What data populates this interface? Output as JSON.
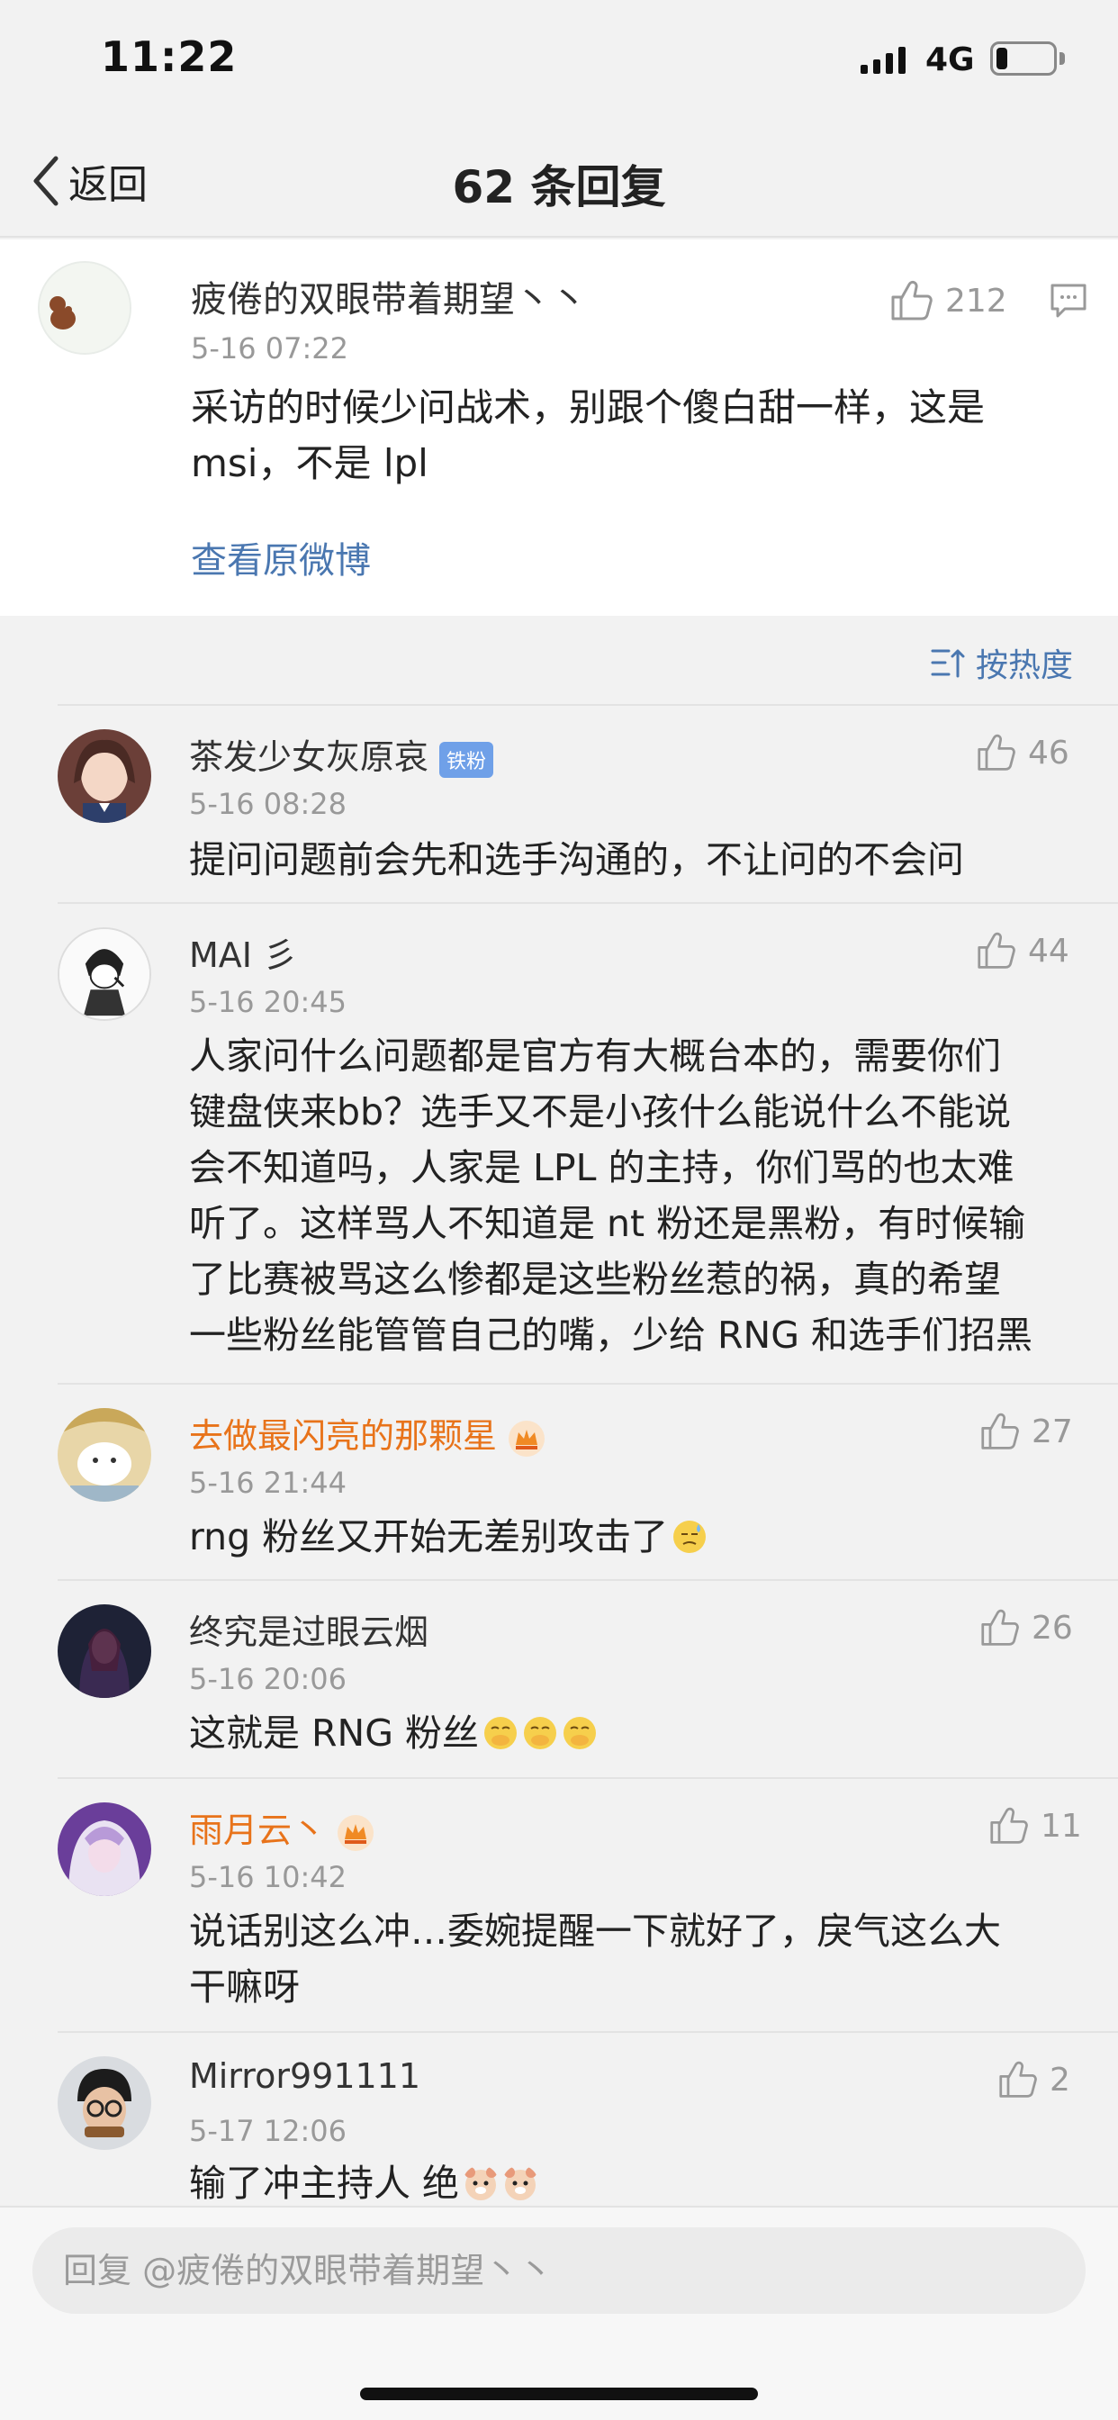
{
  "status": {
    "time": "11:22",
    "network": "4G"
  },
  "nav": {
    "back_label": "返回",
    "title": "62 条回复"
  },
  "original": {
    "username": "疲倦的双眼带着期望丶丶",
    "time": "5-16 07:22",
    "likes": "212",
    "content_lines": [
      "采访的时候少问战术，别跟个傻白甜一样，这是",
      "msi，不是 lpl"
    ],
    "view_original": "查看原微博"
  },
  "sort": {
    "label": "按热度"
  },
  "replies": [
    {
      "username": "茶发少女灰原哀",
      "badge": "铁粉",
      "time": "5-16 08:28",
      "likes": "46",
      "lines": [
        "提问问题前会先和选手沟通的，不让问的不会问"
      ]
    },
    {
      "username": "MAI 彡",
      "time": "5-16 20:45",
      "likes": "44",
      "lines": [
        "人家问什么问题都是官方有大概台本的，需要你们",
        "键盘侠来bb？选手又不是小孩什么能说什么不能说",
        "会不知道吗，人家是 LPL 的主持，你们骂的也太难",
        "听了。这样骂人不知道是 nt 粉还是黑粉，有时候输",
        "了比赛被骂这么惨都是这些粉丝惹的祸，真的希望",
        "一些粉丝能管管自己的嘴，少给 RNG 和选手们招黑"
      ]
    },
    {
      "username": "去做最闪亮的那颗星",
      "time": "5-16 21:44",
      "likes": "27",
      "lines": [
        "rng 粉丝又开始无差别攻击了"
      ]
    },
    {
      "username": "终究是过眼云烟",
      "time": "5-16 20:06",
      "likes": "26",
      "lines": [
        "这就是 RNG 粉丝"
      ]
    },
    {
      "username": "雨月云丶",
      "time": "5-16 10:42",
      "likes": "11",
      "lines": [
        "说话别这么冲…委婉提醒一下就好了，戾气这么大",
        "干嘛呀"
      ]
    },
    {
      "username": "Mirror991111",
      "time": "5-17 12:06",
      "likes": "2",
      "lines": [
        "输了冲主持人 绝"
      ]
    }
  ],
  "input": {
    "placeholder": "回复 @疲倦的双眼带着期望丶丶"
  },
  "colors": {
    "link": "#4a77b0",
    "vip_name": "#e8731a",
    "badge": "#6fa0e8"
  }
}
